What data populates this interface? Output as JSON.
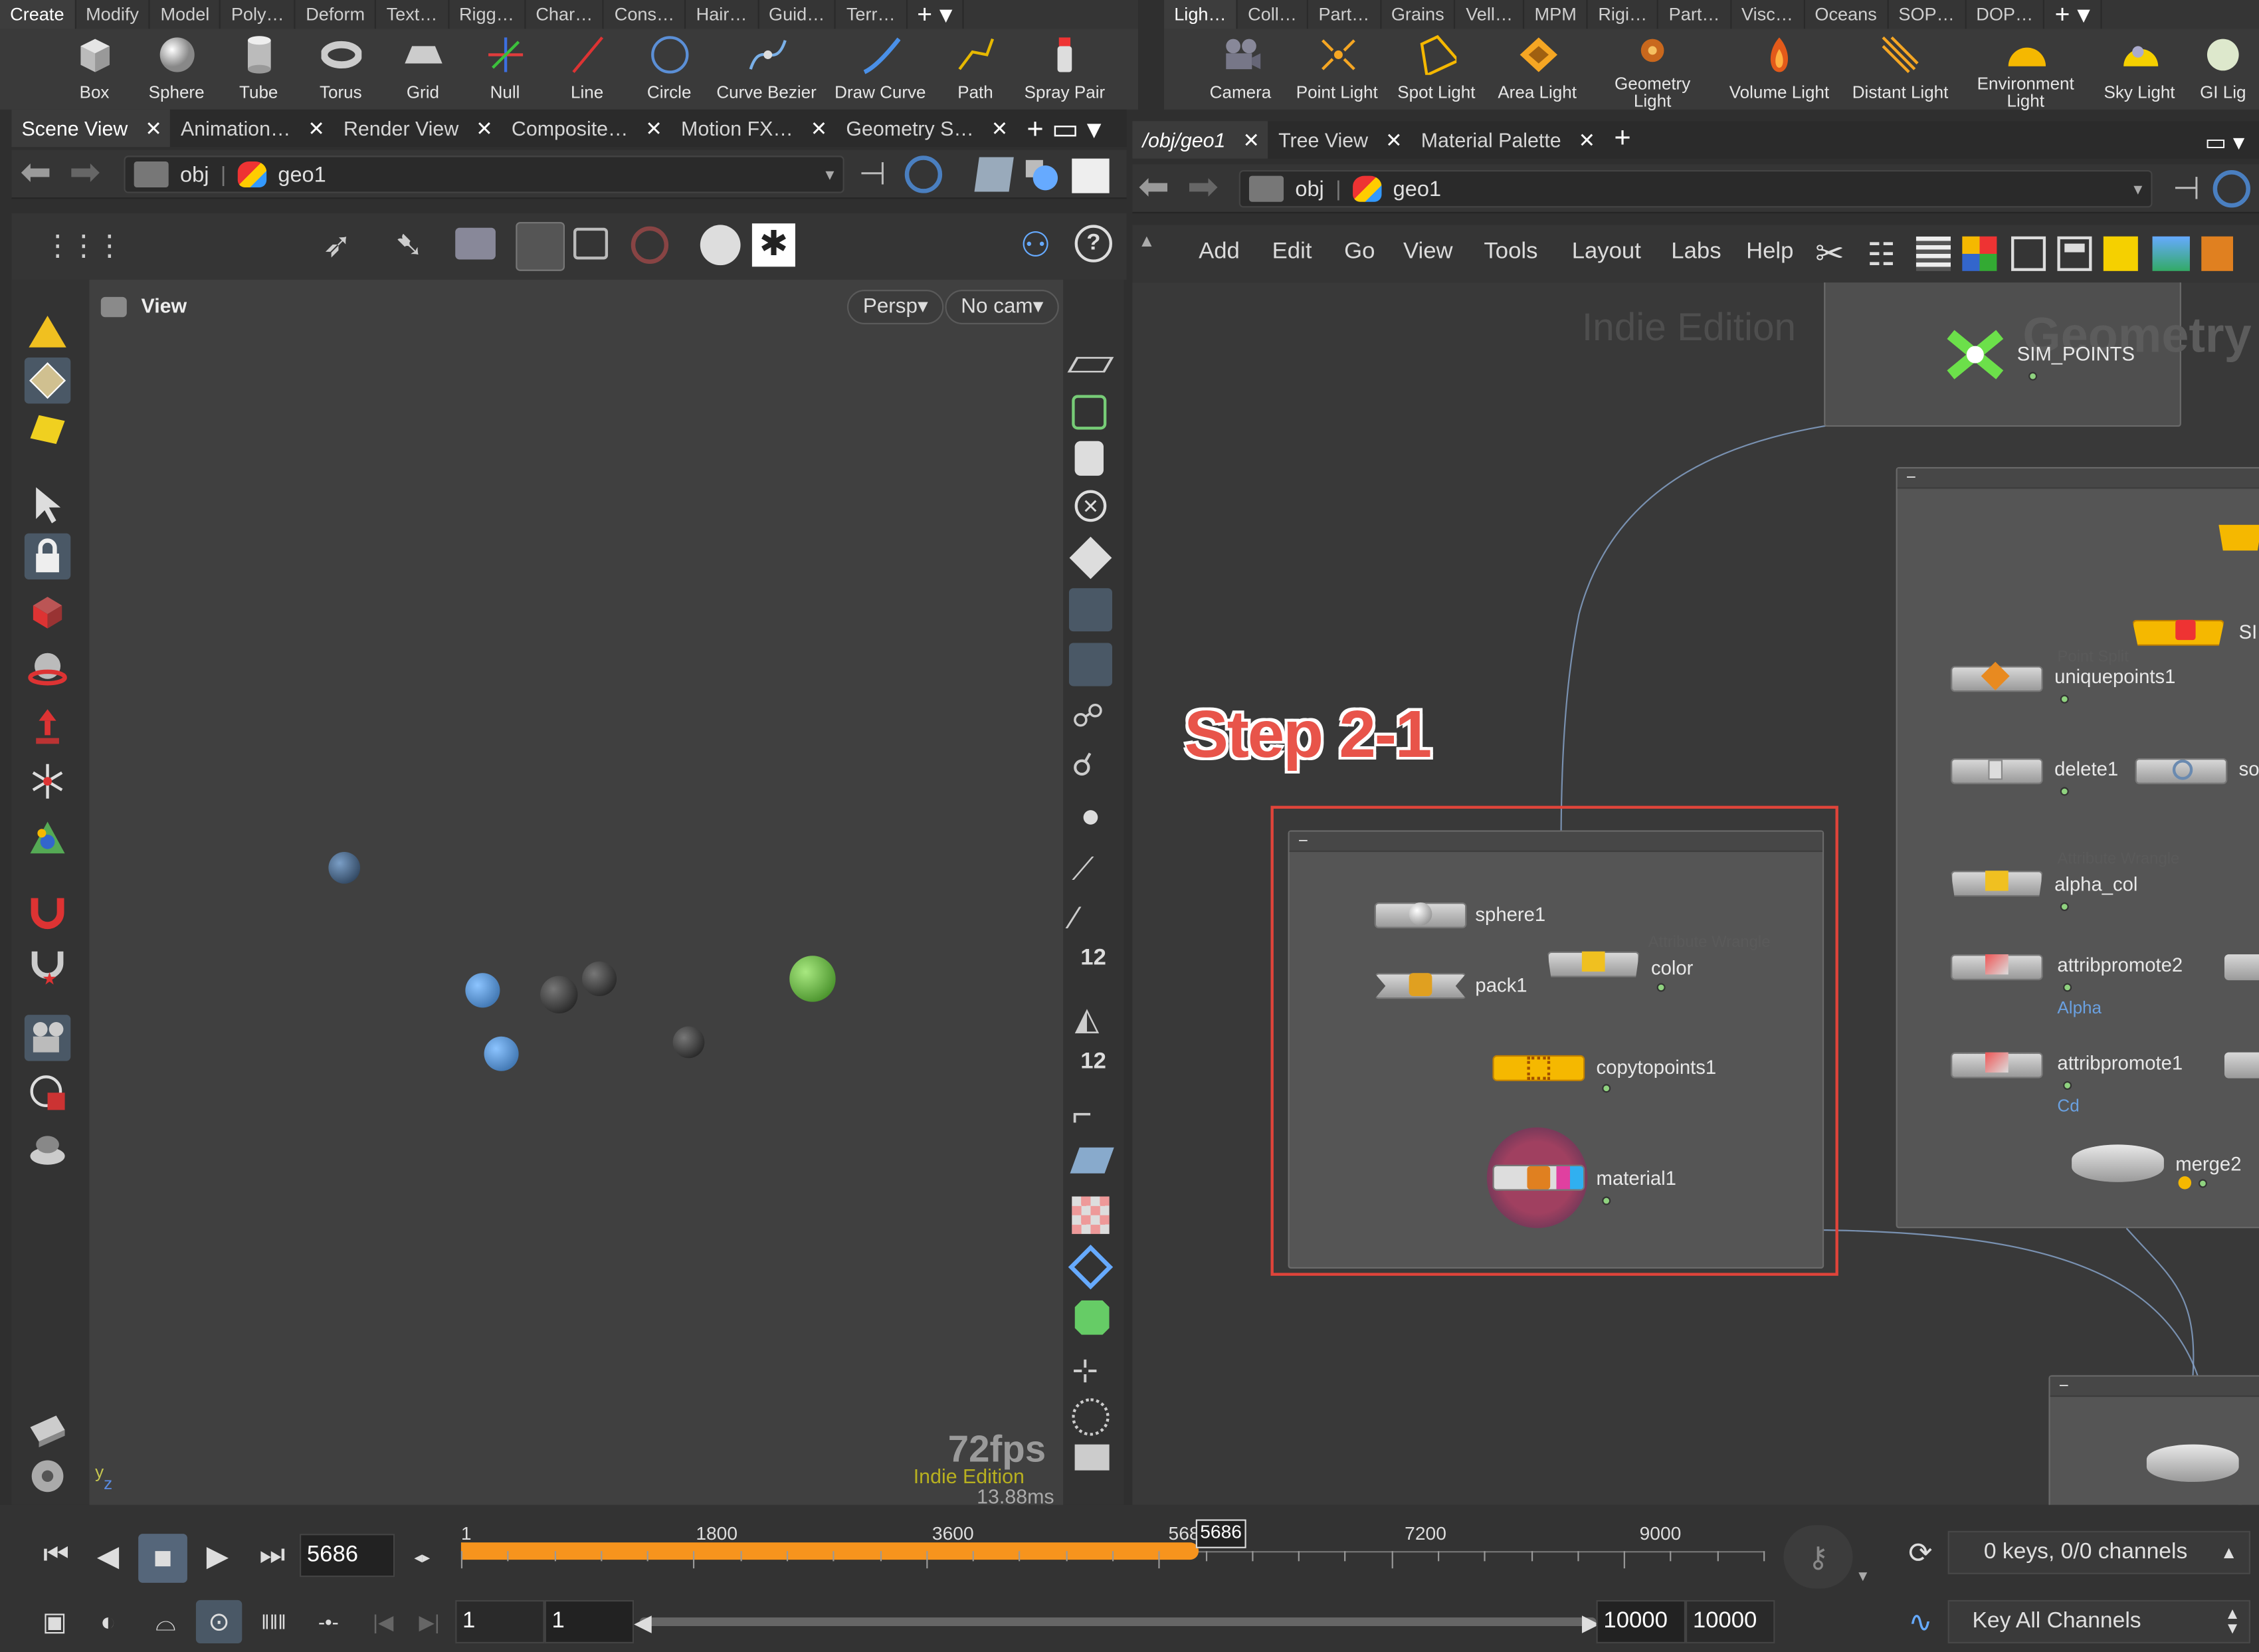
{
  "shelf_left": {
    "tabs": [
      "Create",
      "Modify",
      "Model",
      "Poly…",
      "Deform",
      "Text…",
      "Rigg…",
      "Char…",
      "Cons…",
      "Hair…",
      "Guid…",
      "Terr…"
    ],
    "tools": [
      "Box",
      "Sphere",
      "Tube",
      "Torus",
      "Grid",
      "Null",
      "Line",
      "Circle",
      "Curve Bezier",
      "Draw Curve",
      "Path",
      "Spray Pair"
    ]
  },
  "shelf_right": {
    "tabs": [
      "Ligh…",
      "Coll…",
      "Part…",
      "Grains",
      "Vell…",
      "MPM",
      "Rigi…",
      "Part…",
      "Visc…",
      "Oceans",
      "SOP…",
      "DOP…"
    ],
    "tools": [
      "Camera",
      "Point Light",
      "Spot Light",
      "Area Light",
      "Geometry Light",
      "Volume Light",
      "Distant Light",
      "Environment Light",
      "Sky Light",
      "GI Lig"
    ]
  },
  "left_pane": {
    "tabs": [
      "Scene View",
      "Animation…",
      "Render View",
      "Composite…",
      "Motion FX…",
      "Geometry S…"
    ],
    "path": {
      "root": "obj",
      "node": "geo1"
    },
    "viewport": {
      "label": "View",
      "persp": "Persp",
      "cam": "No cam",
      "fps": "72fps",
      "watermark": "Indie Edition",
      "ms": "13.88ms",
      "axis_y": "y",
      "axis_z": "z"
    }
  },
  "right_pane": {
    "tabs": [
      "/obj/geo1",
      "Tree View",
      "Material Palette"
    ],
    "path": {
      "root": "obj",
      "node": "geo1"
    },
    "menu": [
      "Add",
      "Edit",
      "Go",
      "View",
      "Tools",
      "Layout",
      "Labs",
      "Help"
    ],
    "watermark": "Indie Edition",
    "context_label": "Geometry",
    "annotation": "Step 2-1",
    "nodes": {
      "sim_points": "SIM_POINTS",
      "sphere1": "sphere1",
      "pack1": "pack1",
      "color": "color",
      "color_type": "Attribute Wrangle",
      "copytopoints1": "copytopoints1",
      "material1": "material1",
      "uniquepoints1": "uniquepoints1",
      "uniquepoints1_type": "Point Split",
      "delete1": "delete1",
      "alpha_col": "alpha_col",
      "alpha_col_type": "Attribute Wrangle",
      "attribpromote2": "attribpromote2",
      "attribpromote2_sub": "Alpha",
      "attribpromote1": "attribpromote1",
      "attribpromote1_sub": "Cd",
      "merge2": "merge2",
      "so": "so",
      "si": "SI"
    }
  },
  "timeline": {
    "current_frame": "5686",
    "ticks": [
      "1",
      "1800",
      "3600",
      "5686",
      "7200",
      "9000"
    ],
    "playhead_label": "5686",
    "range_start": "1",
    "range_start2": "1",
    "range_end": "10000",
    "range_end2": "10000",
    "progress_fraction": 0.5686,
    "keys_text": "0 keys, 0/0 channels",
    "key_all": "Key All Channels"
  },
  "colors": {
    "accent_orange": "#f7941d",
    "annotation_red": "#e0443a",
    "node_yellow": "#f5b800"
  }
}
